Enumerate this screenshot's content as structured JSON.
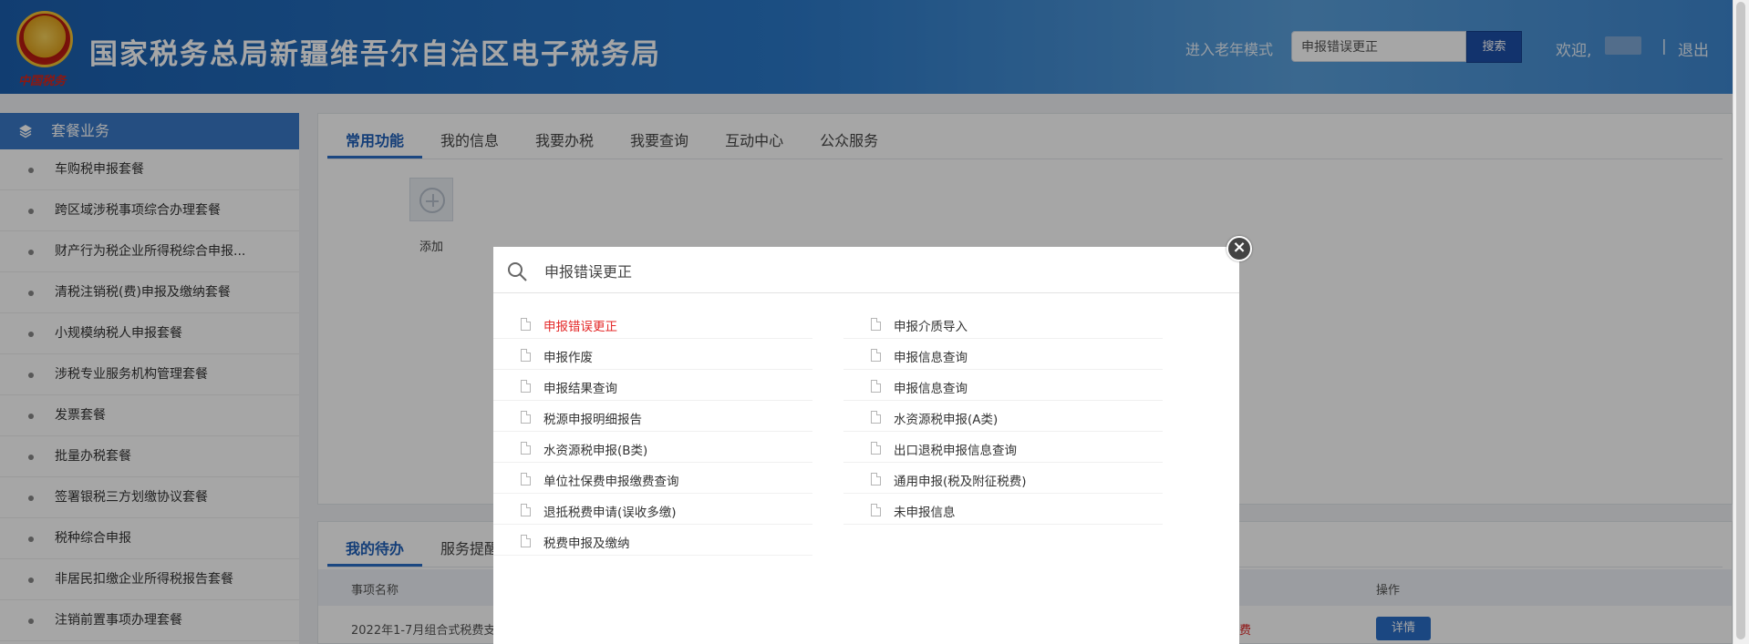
{
  "header": {
    "site_title": "国家税务总局新疆维吾尔自治区电子税务局",
    "emblem_text": "中国税务",
    "elder_mode": "进入老年模式",
    "search_value": "申报错误更正",
    "search_button": "搜索",
    "welcome": "欢迎,",
    "separator": "|",
    "logout": "退出"
  },
  "sidebar": {
    "title": "套餐业务",
    "items": [
      "车购税申报套餐",
      "跨区域涉税事项综合办理套餐",
      "财产行为税企业所得税综合申报...",
      "清税注销税(费)申报及缴纳套餐",
      "小规模纳税人申报套餐",
      "涉税专业服务机构管理套餐",
      "发票套餐",
      "批量办税套餐",
      "签署银税三方划缴协议套餐",
      "税种综合申报",
      "非居民扣缴企业所得税报告套餐",
      "注销前置事项办理套餐"
    ]
  },
  "main_tabs": [
    "常用功能",
    "我的信息",
    "我要办税",
    "我要查询",
    "互动中心",
    "公众服务"
  ],
  "add_label": "添加",
  "todo": {
    "tabs": [
      "我的待办",
      "服务提醒"
    ],
    "col_name": "事项名称",
    "col_op": "操作",
    "row_name": "2022年1-7月组合式税费支",
    "row_status": "费",
    "detail_button": "详情"
  },
  "modal": {
    "query": "申报错误更正",
    "left_results": [
      "申报错误更正",
      "申报作废",
      "申报结果查询",
      "税源申报明细报告",
      "水资源税申报(B类)",
      "单位社保费申报缴费查询",
      "退抵税费申请(误收多缴)",
      "税费申报及缴纳"
    ],
    "right_results": [
      "申报介质导入",
      "申报信息查询",
      "申报信息查询",
      "水资源税申报(A类)",
      "出口退税申报信息查询",
      "通用申报(税及附征税费)",
      "未申报信息"
    ],
    "close": "×"
  },
  "colors": {
    "header_blue": "#2a78c8",
    "accent": "#2a6ec6",
    "highlight": "#e42a2a"
  }
}
